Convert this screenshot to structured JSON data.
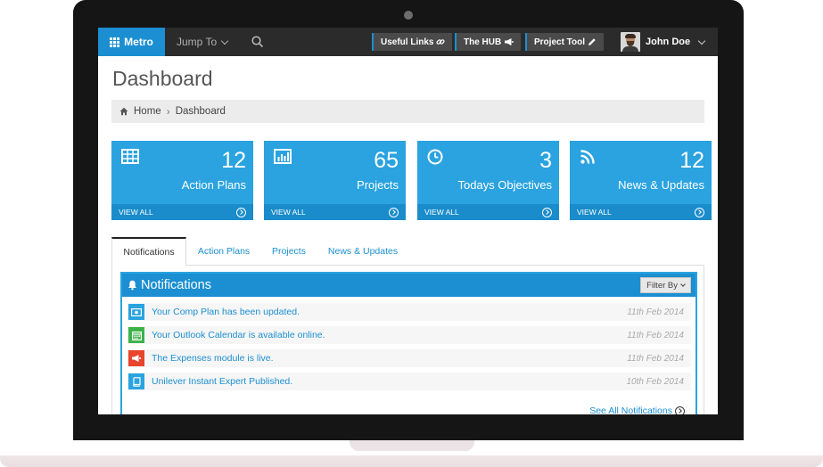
{
  "navbar": {
    "brand": "Metro",
    "jump_to": "Jump To",
    "buttons": [
      "Useful Links",
      "The HUB",
      "Project Tool"
    ],
    "user_name": "John Doe"
  },
  "page": {
    "title": "Dashboard",
    "breadcrumb": [
      "Home",
      "Dashboard"
    ]
  },
  "tiles": [
    {
      "count": "12",
      "label": "Action Plans",
      "footer": "VIEW ALL",
      "icon": "table-icon"
    },
    {
      "count": "65",
      "label": "Projects",
      "footer": "VIEW ALL",
      "icon": "bar-chart-icon"
    },
    {
      "count": "3",
      "label": "Todays Objectives",
      "footer": "VIEW ALL",
      "icon": "clock-icon"
    },
    {
      "count": "12",
      "label": "News & Updates",
      "footer": "VIEW ALL",
      "icon": "rss-icon"
    }
  ],
  "tabs": [
    "Notifications",
    "Action Plans",
    "Projects",
    "News & Updates"
  ],
  "notifications": {
    "title": "Notifications",
    "filter_label": "Filter By",
    "items": [
      {
        "text": "Your Comp Plan has been updated.",
        "date": "11th Feb 2014",
        "icon": "money-icon",
        "color": "#2aa3e0"
      },
      {
        "text": "Your Outlook Calendar is available online.",
        "date": "11th Feb 2014",
        "icon": "calendar-icon",
        "color": "#3cb34a"
      },
      {
        "text": "The Expenses module is live.",
        "date": "11th Feb 2014",
        "icon": "megaphone-icon",
        "color": "#e8452c"
      },
      {
        "text": "Unilever Instant Expert Published.",
        "date": "10th Feb 2014",
        "icon": "book-icon",
        "color": "#2aa3e0"
      }
    ],
    "see_all": "See All Notifications"
  },
  "colors": {
    "accent": "#1b8fd1",
    "tile": "#2aa3e0",
    "navbar": "#2b2b2b"
  }
}
